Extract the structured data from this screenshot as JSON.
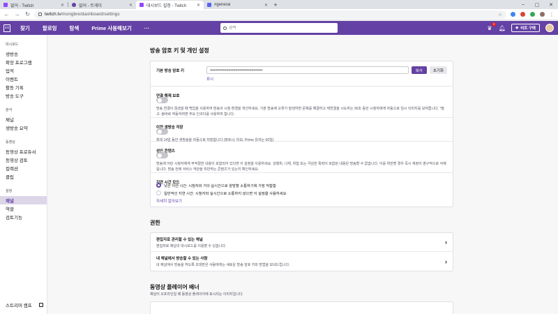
{
  "browser": {
    "tabs": [
      {
        "label": "없어 - Twitch",
        "color": "#9147ff",
        "active": false
      },
      {
        "label": "없어 - 트게더",
        "color": "#6441a4",
        "active": false
      },
      {
        "label": "대시보드 설정 - Twitch",
        "color": "#9147ff",
        "active": true
      },
      {
        "label": "#general",
        "color": "#5865f2",
        "active": false
      }
    ],
    "url_host": "twitch.tv",
    "url_path": "/mongbre/dashboard/settings"
  },
  "topnav": {
    "items": [
      "찾기",
      "팔로잉",
      "탐색",
      "Prime 사용해보기"
    ],
    "more": "···",
    "search_placeholder": "검색",
    "notif_count": "2",
    "prime_button": "비트 구매"
  },
  "sidebar": {
    "sections": [
      {
        "title": "대시보드",
        "items": [
          "생방송",
          "확장 프로그램",
          "업적",
          "이벤트",
          "활동 기록",
          "방송 도구"
        ]
      },
      {
        "title": "분석",
        "items": [
          "채널",
          "생방송 요약"
        ]
      },
      {
        "title": "동영상",
        "items": [
          "동영상 프로듀서",
          "동영상 검토",
          "컬렉션",
          "클립"
        ]
      },
      {
        "title": "설정",
        "items": [
          "채널",
          "역할",
          "검토기능"
        ]
      }
    ],
    "active_item": "채널",
    "footer": "스트리머 캠프"
  },
  "stream_key_section": {
    "title": "방송 암호 키 및 개인 설정",
    "key_label": "기본 방송 암호 키",
    "key_value": "••••••••••••••••••••••••••••••••••••••••••••••••••••",
    "copy_button": "복사",
    "reset_button": "초기화",
    "show_link": "표시",
    "disconnect_label": "연결 해제 보호",
    "disconnect_desc": "방송 연결이 끊겼을 때 백업을 사용하여 방송의 시청 환경을 개선하세요. 기본 방송에 오류가 발생하면 문제를 해결하고 재연결을 시도하는 90초 동안 시청자에게 자동으로 임시 이미지를 보여줍니다. *참고: 올바로 작동하려면 주요 인코더를 사용하여 합니다.",
    "archive_label": "이전 생방송 저장",
    "archive_desc": "최대 14일 동안 생방송을 자동으로 저장합니다 (파트너, 터보, Prime 유저는 60일)",
    "mature_label": "성인 콘텐츠",
    "mature_desc": "방송에 어린 시청자에게 부적절한 내용이 포함되어 있다면 이 설정을 사용하세요. 성행위, 나체, 위험 또는 극심한 폭력이 포함된 내용은 방송할 수 없습니다. 이를 위반할 경우 즉시 계정이 영구적으로 삭제됩니다. 방송 전에 서비스 약관을 위반하는 콘텐츠가 있는지 확인하세요.",
    "latency_label": "지연 시간 모드",
    "latency_low": "낮은 지연 시간: 시청자와 거의 실시간으로 양방향 소통하기에 가장 적합함",
    "latency_normal": "일반적인 지연 시간: 시청자와 실시간으로 소통하지 않으면 이 설정을 사용하세요",
    "learn_more": "자세히 알아보기"
  },
  "permissions": {
    "title": "권한",
    "rows": [
      {
        "title": "편집자로 관리할 수 있는 채널",
        "sub": "편집자로 채널의 대시보드를 이용할 수 있습니다."
      },
      {
        "title": "내 채널에서 방송할 수 있는 사람",
        "sub": "내 채널에서 방송을 허도록 초대받은 사람에게는 새로운 방송 암호 키와 방법을 보내드립니다."
      }
    ]
  },
  "banner": {
    "title": "동영상 플레이어 배너",
    "sub": "채널이 오프라인일 때 동영상 플레이어에 표시되는 이미지입니다."
  }
}
